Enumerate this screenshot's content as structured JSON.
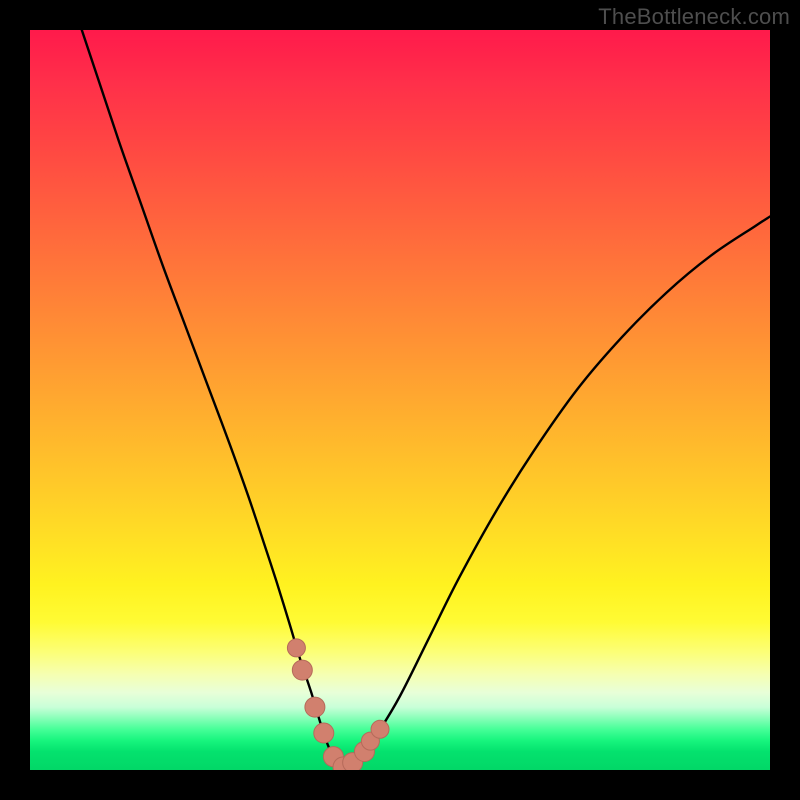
{
  "credit": "TheBottleneck.com",
  "colors": {
    "frame": "#000000",
    "curve_stroke": "#000000",
    "marker_fill": "#d1806e",
    "marker_stroke": "#b56a5a"
  },
  "chart_data": {
    "type": "line",
    "title": "",
    "xlabel": "",
    "ylabel": "",
    "xlim": [
      0,
      100
    ],
    "ylim": [
      0,
      100
    ],
    "grid": false,
    "series": [
      {
        "name": "bottleneck-curve",
        "x": [
          7.0,
          9.0,
          12.0,
          15.0,
          18.0,
          21.0,
          24.0,
          27.0,
          29.5,
          31.5,
          33.3,
          35.0,
          36.5,
          38.0,
          39.2,
          40.2,
          41.2,
          42.0,
          43.5,
          45.0,
          47.0,
          50.0,
          54.0,
          58.0,
          63.0,
          68.0,
          74.0,
          80.0,
          86.0,
          92.0,
          98.0,
          100.0
        ],
        "values": [
          100.0,
          94.0,
          85.0,
          76.5,
          68.0,
          60.0,
          52.0,
          44.0,
          37.0,
          31.0,
          25.5,
          20.0,
          15.0,
          10.5,
          6.5,
          3.5,
          1.4,
          0.4,
          0.8,
          2.2,
          5.0,
          10.0,
          18.0,
          26.0,
          35.0,
          43.0,
          51.5,
          58.5,
          64.5,
          69.5,
          73.5,
          74.8
        ]
      }
    ],
    "markers": {
      "name": "highlight-points",
      "x": [
        36.0,
        36.8,
        38.5,
        39.7,
        41.0,
        42.3,
        43.6,
        45.2,
        46.0,
        47.3
      ],
      "values": [
        16.5,
        13.5,
        8.5,
        5.0,
        1.8,
        0.4,
        1.0,
        2.5,
        3.9,
        5.5
      ],
      "radius": [
        9,
        10,
        10,
        10,
        10,
        10,
        10,
        10,
        9,
        9
      ]
    }
  }
}
